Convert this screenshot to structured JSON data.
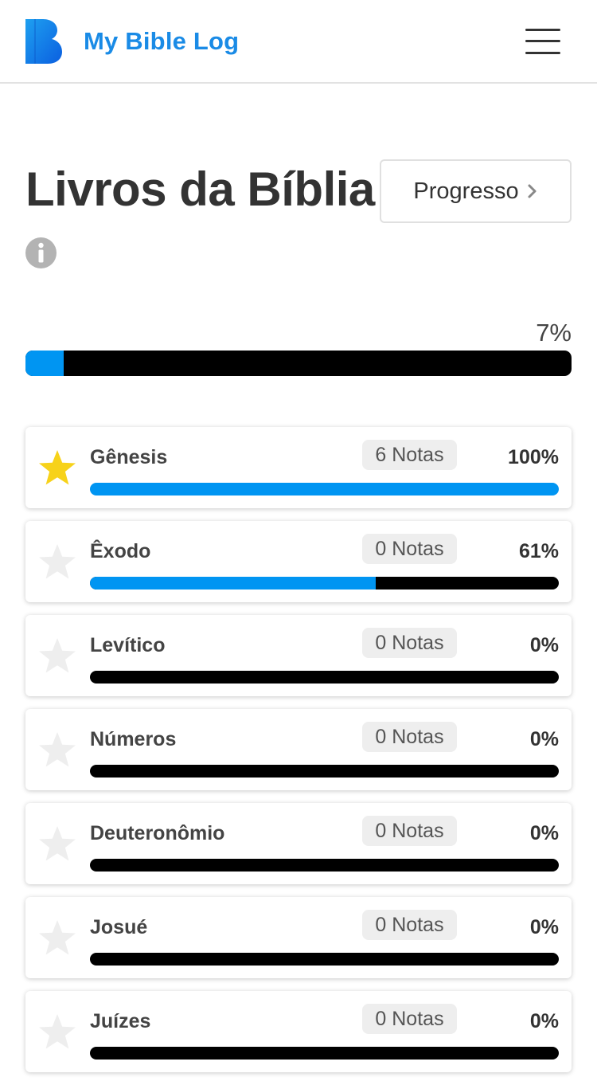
{
  "header": {
    "brand": "My Bible Log",
    "menu_icon": "hamburger-menu-icon",
    "logo_icon": "bible-log-logo-icon",
    "brand_color": "#1a8be6"
  },
  "page": {
    "title": "Livros da Bíblia",
    "progress_button": "Progresso",
    "info_icon": "info-icon"
  },
  "overall": {
    "percent_label": "7%",
    "fraction": 0.07
  },
  "colors": {
    "accent": "#0095f2",
    "track": "#000000",
    "star_active": "#f7d21a",
    "star_inactive": "#eeeeee"
  },
  "books": [
    {
      "name": "Gênesis",
      "notes": "6 Notas",
      "percent_label": "100%",
      "fraction": 1.0,
      "starred": true
    },
    {
      "name": "Êxodo",
      "notes": "0 Notas",
      "percent_label": "61%",
      "fraction": 0.61,
      "starred": false
    },
    {
      "name": "Levítico",
      "notes": "0 Notas",
      "percent_label": "0%",
      "fraction": 0,
      "starred": false
    },
    {
      "name": "Números",
      "notes": "0 Notas",
      "percent_label": "0%",
      "fraction": 0,
      "starred": false
    },
    {
      "name": "Deuteronômio",
      "notes": "0 Notas",
      "percent_label": "0%",
      "fraction": 0,
      "starred": false
    },
    {
      "name": "Josué",
      "notes": "0 Notas",
      "percent_label": "0%",
      "fraction": 0,
      "starred": false
    },
    {
      "name": "Juízes",
      "notes": "0 Notas",
      "percent_label": "0%",
      "fraction": 0,
      "starred": false
    }
  ]
}
